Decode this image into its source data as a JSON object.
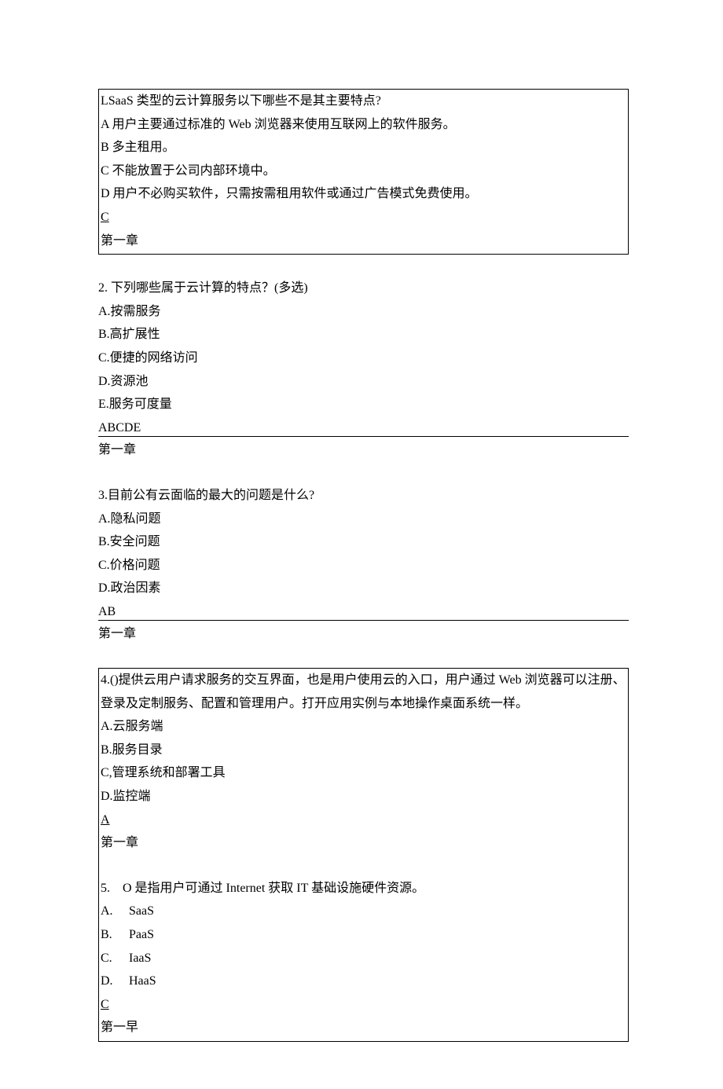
{
  "q1": {
    "question": "LSaaS 类型的云计算服务以下哪些不是其主要特点?",
    "opts": {
      "A": "A 用户主要通过标准的 Web 浏览器来使用互联网上的软件服务。",
      "B": "B 多主租用。",
      "C": "C 不能放置于公司内部环境中。",
      "D": "D 用户不必购买软件，只需按需租用软件或通过广告模式免费使用。"
    },
    "answer": "C",
    "chapter": "第一章"
  },
  "q2": {
    "question": "2. 下列哪些属于云计算的特点？(多选)",
    "opts": {
      "A": "A.按需服务",
      "B": "B.高扩展性",
      "C": "C.便捷的网络访问",
      "D": "D.资源池",
      "E": "E.服务可度量"
    },
    "answer": "ABCDE",
    "chapter": "第一章"
  },
  "q3": {
    "question": "3.目前公有云面临的最大的问题是什么?",
    "opts": {
      "A": "A.隐私问题",
      "B": "B.安全问题",
      "C": "C.价格问题",
      "D": "D.政治因素"
    },
    "answer": "AB",
    "chapter": "第一章"
  },
  "q4": {
    "question": "4.()提供云用户请求服务的交互界面，也是用户使用云的入口，用户通过 Web 浏览器可以注册、登录及定制服务、配置和管理用户。打开应用实例与本地操作桌面系统一样。",
    "opts": {
      "A": "A.云服务端",
      "B": "B.服务目录",
      "C": "C,管理系统和部署工具",
      "D": "D.监控端"
    },
    "answer": "A",
    "chapter": "第一章"
  },
  "q5": {
    "question": "5.    O 是指用户可通过 Internet 获取 IT 基础设施硬件资源。",
    "opts": {
      "A": {
        "label": "A.",
        "text": "SaaS"
      },
      "B": {
        "label": "B.",
        "text": "PaaS"
      },
      "C": {
        "label": "C.",
        "text": "IaaS"
      },
      "D": {
        "label": "D.",
        "text": "HaaS"
      }
    },
    "answer": "C",
    "chapter": "第一早"
  }
}
